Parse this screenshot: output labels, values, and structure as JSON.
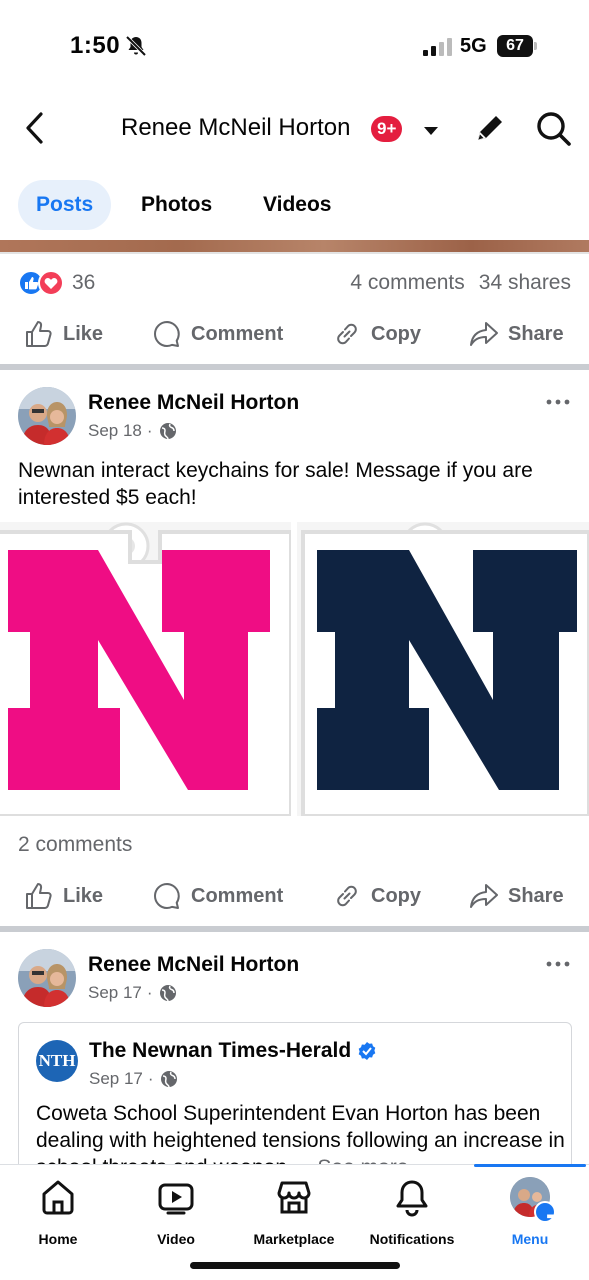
{
  "status_bar": {
    "time": "1:50",
    "network": "5G",
    "battery": "67"
  },
  "header": {
    "title": "Renee McNeil Horton",
    "badge": "9+"
  },
  "tabs": [
    {
      "label": "Posts",
      "active": true
    },
    {
      "label": "Photos",
      "active": false
    },
    {
      "label": "Videos",
      "active": false
    }
  ],
  "previous_post": {
    "reaction_count": "36",
    "comments": "4 comments",
    "shares": "34 shares"
  },
  "actions": {
    "like": "Like",
    "comment": "Comment",
    "copy": "Copy",
    "share": "Share"
  },
  "post1": {
    "author": "Renee McNeil Horton",
    "date": "Sep 18",
    "text": "Newnan interact keychains for sale! Message if you are interested $5 each!",
    "comments": "2 comments",
    "image_colors": [
      "#ef0d84",
      "#0f2341"
    ]
  },
  "post2": {
    "author": "Renee McNeil Horton",
    "date": "Sep 17",
    "shared": {
      "logo_text": "NTH",
      "author": "The Newnan Times-Herald",
      "date": "Sep 17",
      "text": "Coweta School Superintendent Evan Horton has been dealing with heightened tensions following an increase in school threats and weapon-...",
      "see_more": "See more"
    }
  },
  "bottom_nav": [
    {
      "label": "Home",
      "icon": "home-icon"
    },
    {
      "label": "Video",
      "icon": "video-icon"
    },
    {
      "label": "Marketplace",
      "icon": "marketplace-icon"
    },
    {
      "label": "Notifications",
      "icon": "bell-icon"
    },
    {
      "label": "Menu",
      "icon": "menu-avatar",
      "active": true
    }
  ],
  "colors": {
    "accent": "#1877f2",
    "badge": "#e41e3f",
    "secondary_text": "#65676b"
  }
}
